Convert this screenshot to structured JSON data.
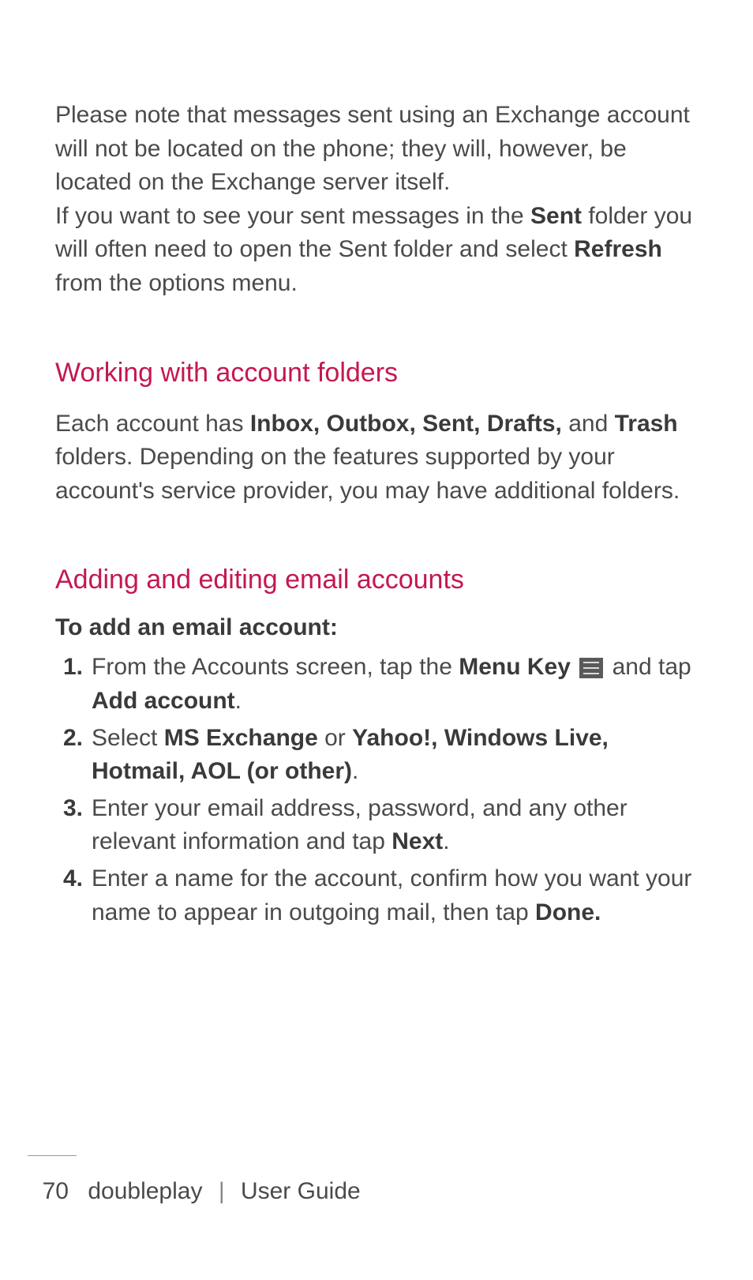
{
  "intro": {
    "para1": "Please note that messages sent using an Exchange account will not be located on the phone; they will, however, be located on the Exchange server itself.",
    "para2_pre": "If you want to see your sent messages in the ",
    "para2_bold1": "Sent",
    "para2_mid": " folder you will often need to open the Sent folder and select ",
    "para2_bold2": "Refresh",
    "para2_post": " from the options menu."
  },
  "section1": {
    "heading": "Working with account folders",
    "body_pre": "Each account has ",
    "body_bold1": "Inbox, Outbox, Sent, Drafts,",
    "body_mid1": " and ",
    "body_bold2": "Trash",
    "body_post": " folders. Depending on the features supported by your account's service provider, you may have additional folders."
  },
  "section2": {
    "heading": "Adding and editing email accounts",
    "subheading": "To add an email account:",
    "steps": {
      "s1_num": "1.",
      "s1_pre": " From the Accounts screen, tap the ",
      "s1_bold1": "Menu Key",
      "s1_mid": " and tap ",
      "s1_bold2": "Add account",
      "s1_post": ".",
      "s2_num": "2.",
      "s2_pre": "Select ",
      "s2_bold1": "MS Exchange",
      "s2_mid": " or ",
      "s2_bold2": "Yahoo!, Windows Live, Hotmail, AOL (or other)",
      "s2_post": ".",
      "s3_num": "3.",
      "s3_pre": "Enter your email address, password, and any other relevant information and tap ",
      "s3_bold": "Next",
      "s3_post": ".",
      "s4_num": "4.",
      "s4_pre": "Enter a name for the account, confirm how you want your name to appear in outgoing mail, then tap ",
      "s4_bold": "Done.",
      "s4_post": ""
    }
  },
  "footer": {
    "page_number": "70",
    "product": "doubleplay",
    "divider": "|",
    "doc_title": "User Guide"
  }
}
